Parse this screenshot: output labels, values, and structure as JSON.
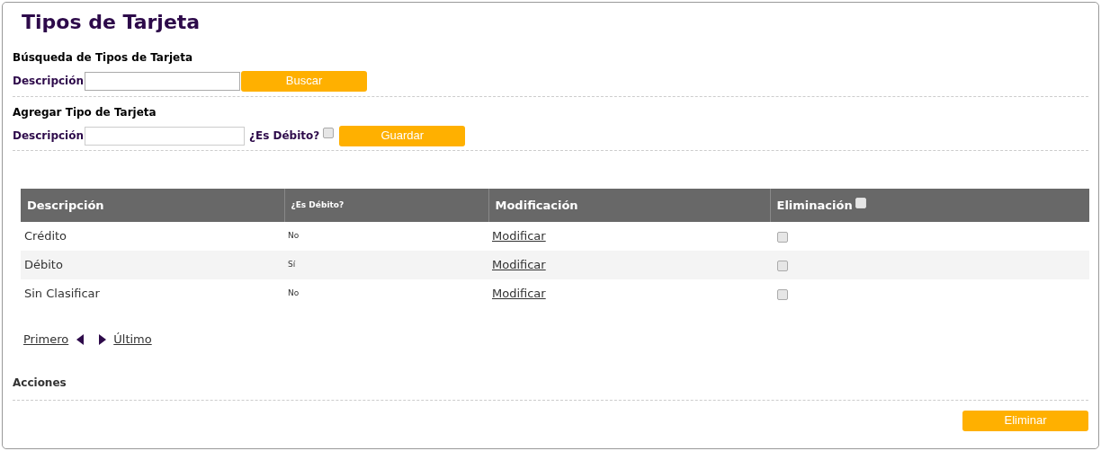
{
  "title": "Tipos de Tarjeta",
  "search": {
    "heading": "Búsqueda de Tipos de Tarjeta",
    "label": "Descripción",
    "button": "Buscar"
  },
  "add": {
    "heading": "Agregar Tipo de Tarjeta",
    "label": "Descripción",
    "debit_label": "¿Es Débito?",
    "debit_checked": false,
    "button": "Guardar"
  },
  "table": {
    "columns": [
      "Descripción",
      "¿Es Débito?",
      "Modificación",
      "Eliminación"
    ],
    "select_all_checked": false,
    "rows": [
      {
        "description": "Crédito",
        "debit": "No",
        "link": "Modificar",
        "checked": false
      },
      {
        "description": "Débito",
        "debit": "Sí",
        "link": "Modificar",
        "checked": false
      },
      {
        "description": "Sin Clasificar",
        "debit": "No",
        "link": "Modificar",
        "checked": false
      }
    ]
  },
  "pagination": {
    "first": "Primero",
    "last": "Último"
  },
  "actions": {
    "heading": "Acciones",
    "button": "Eliminar"
  }
}
